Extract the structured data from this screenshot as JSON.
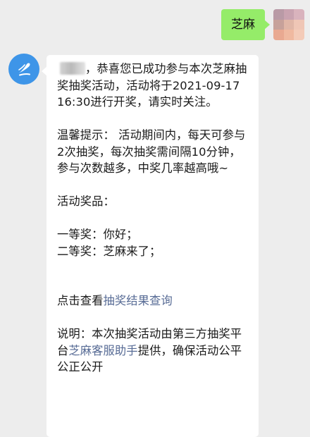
{
  "outgoing": {
    "text": "芝麻"
  },
  "user_avatar_colors": [
    "#b99aa6",
    "#c9a3b0",
    "#d9b3bd",
    "#c7a19a",
    "#e0b6a7",
    "#efc6b6",
    "#e9a991",
    "#f0b9a0",
    "#f4cbb8"
  ],
  "bot_avatar": {
    "icon": "bot-logo-icon",
    "color": "#3e95e8"
  },
  "incoming": {
    "p1": "，恭喜您已成功参与本次芝麻抽奖抽奖活动，活动将于2021-09-17 16:30进行开奖，请实时关注。",
    "p2": "温馨提示： 活动期间内，每天可参与2次抽奖，每次抽奖需间隔10分钟，参与次数越多，中奖几率越高哦~",
    "p3": "活动奖品：",
    "prize1": "一等奖：你好；",
    "prize2": "二等奖：芝麻来了；",
    "check_prefix": "点击查看",
    "check_link": "抽奖结果查询",
    "note_prefix": "说明：本次抽奖活动由第三方抽奖平台",
    "note_link": "芝麻客服助手",
    "note_suffix": "提供，确保活动公平公正公开"
  }
}
